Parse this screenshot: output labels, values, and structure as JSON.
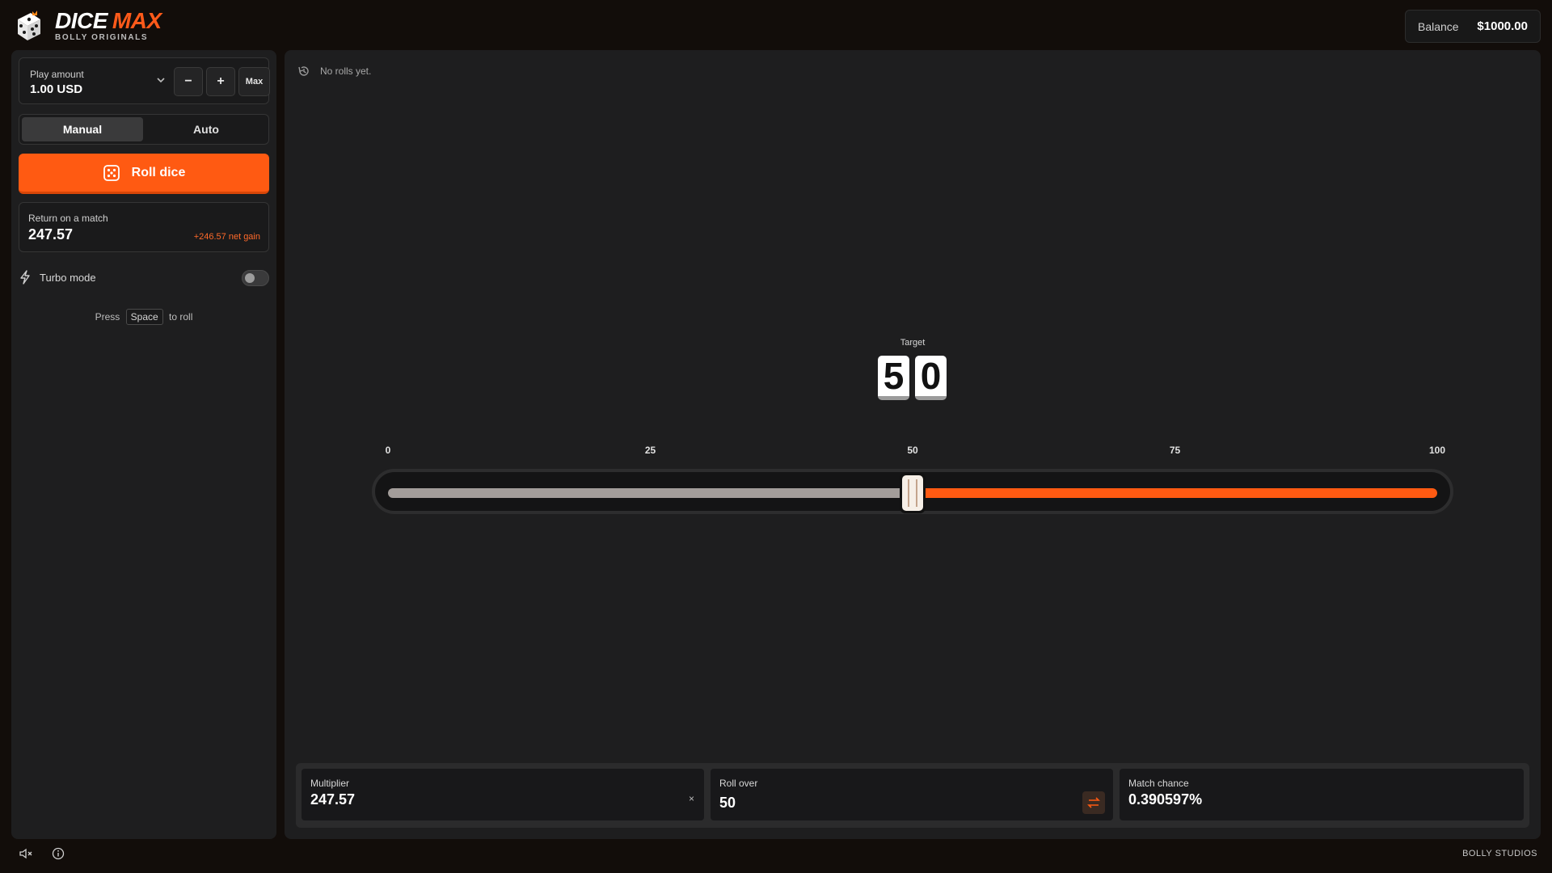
{
  "header": {
    "logo_title_1": "DICE",
    "logo_title_2": "MAX",
    "logo_subtitle": "BOLLY ORIGINALS",
    "balance_label": "Balance",
    "balance_value": "$1000.00"
  },
  "left": {
    "play_amount_label": "Play amount",
    "play_amount_value": "1.00 USD",
    "minus_label": "−",
    "plus_label": "+",
    "max_label": "Max",
    "modes": {
      "manual": "Manual",
      "auto": "Auto",
      "active": "manual"
    },
    "roll_label": "Roll dice",
    "return_label": "Return on a match",
    "return_value": "247.57",
    "net_gain": "+246.57 net gain",
    "turbo_label": "Turbo mode",
    "turbo_on": false,
    "hint_press": "Press",
    "hint_key": "Space",
    "hint_after": "to roll"
  },
  "main": {
    "history_text": "No rolls yet.",
    "target_label": "Target",
    "target_digits": [
      "5",
      "0"
    ],
    "slider": {
      "min": 0,
      "max": 100,
      "value": 50,
      "ticks": [
        "0",
        "25",
        "50",
        "75",
        "100"
      ]
    }
  },
  "stats": {
    "multiplier_label": "Multiplier",
    "multiplier_value": "247.57",
    "multiplier_suffix": "×",
    "roll_over_label": "Roll over",
    "roll_over_value": "50",
    "match_chance_label": "Match chance",
    "match_chance_value": "0.390597%"
  },
  "footer": {
    "brand": "BOLLY STUDIOS"
  },
  "colors": {
    "accent": "#ff5a12",
    "track_low": "#a39d9a",
    "panel": "#1e1e1f"
  },
  "icons": {
    "logo": "dice-logo-icon",
    "chevron": "chevron-down-icon",
    "roll": "dice-icon",
    "turbo": "lightning-icon",
    "history": "history-icon",
    "swap": "swap-icon",
    "sound": "mute-icon",
    "info": "info-icon"
  }
}
